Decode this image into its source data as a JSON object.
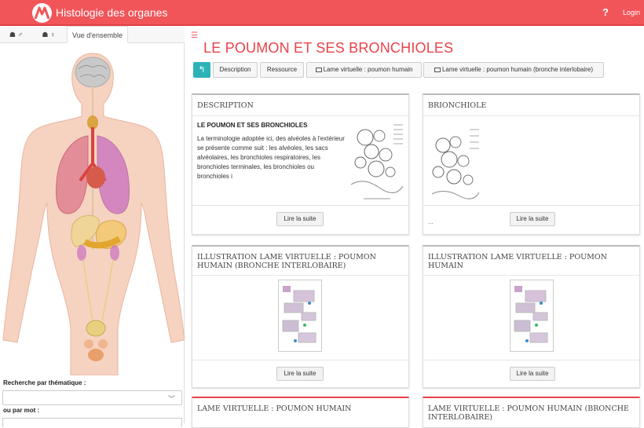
{
  "header": {
    "title": "Histologie des organes",
    "help": "?",
    "login": "Login"
  },
  "left": {
    "tabs": [
      {
        "label": "☗ ♂"
      },
      {
        "label": "☗ ♀"
      },
      {
        "label": "Vue d'ensemble"
      }
    ],
    "theme_label": "Recherche par thématique :",
    "word_label": "ou par mot :",
    "select_value": ""
  },
  "main": {
    "title": "LE POUMON ET SES BRONCHIOLES",
    "back_icon": "↰",
    "buttons": [
      {
        "label": "Description"
      },
      {
        "label": "Ressource"
      },
      {
        "label": "Lame virtuelle : poumon humain"
      },
      {
        "label": "Lame virtuelle : poumon humain (bronche interlobaire)"
      }
    ]
  },
  "cards": [
    {
      "title": "DESCRIPTION",
      "subtitle": "LE POUMON ET SES BRONCHIOLES",
      "text": "La terminologie adoptée ici, des alvéoles à l'extérieur se présente comme suit : les alvéoles, les sacs alvéolaires, les bronchioles respiratoires, les bronchioles terminales, les bronchioles ou bronchioles i",
      "more": "Lire la suite"
    },
    {
      "title": "BRIONCHIOLE",
      "ellipsis": "...",
      "more": "Lire la suite"
    },
    {
      "title": "ILLUSTRATION LAME VIRTUELLE : POUMON HUMAIN (BRONCHE INTERLOBAIRE)",
      "more": "Lire la suite"
    },
    {
      "title": "ILLUSTRATION LAME VIRTUELLE : POUMON HUMAIN",
      "more": "Lire la suite"
    },
    {
      "title": "LAME VIRTUELLE : POUMON HUMAIN"
    },
    {
      "title": "LAME VIRTUELLE : POUMON HUMAIN (BRONCHE INTERLOBAIRE)"
    }
  ]
}
